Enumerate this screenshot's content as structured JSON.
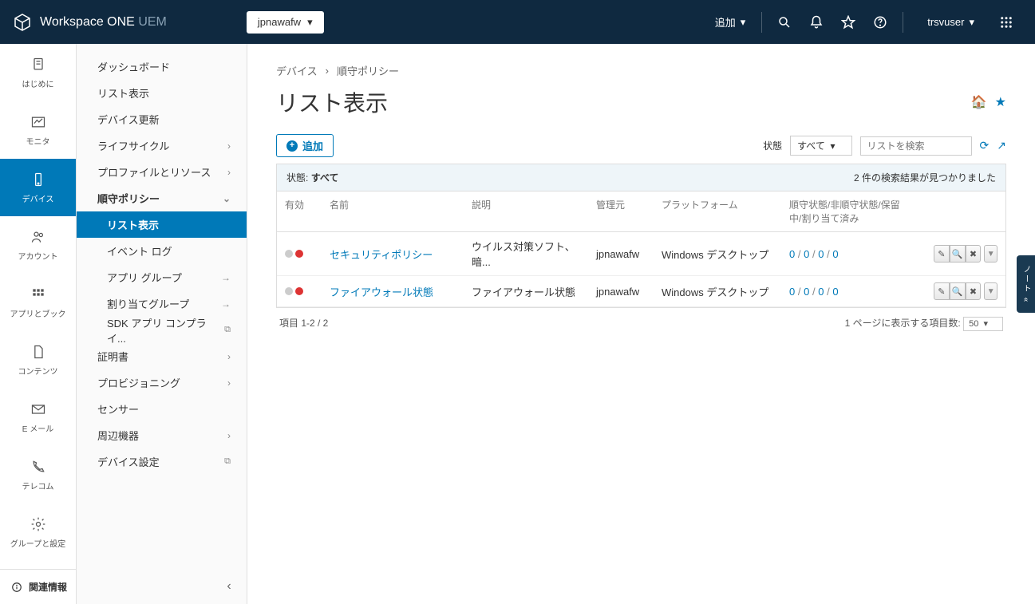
{
  "header": {
    "product": "Workspace ONE",
    "suffix": "UEM",
    "org": "jpnawafw",
    "add_label": "追加",
    "user": "trsvuser"
  },
  "rail": {
    "items": [
      {
        "label": "はじめに"
      },
      {
        "label": "モニタ"
      },
      {
        "label": "デバイス"
      },
      {
        "label": "アカウント"
      },
      {
        "label": "アプリとブック"
      },
      {
        "label": "コンテンツ"
      },
      {
        "label": "E メール"
      },
      {
        "label": "テレコム"
      },
      {
        "label": "グループと設定"
      }
    ],
    "footer": "関連情報"
  },
  "sidenav": {
    "items": [
      {
        "label": "ダッシュボード"
      },
      {
        "label": "リスト表示"
      },
      {
        "label": "デバイス更新"
      },
      {
        "label": "ライフサイクル",
        "chev": "›"
      },
      {
        "label": "プロファイルとリソース",
        "chev": "›"
      },
      {
        "label": "順守ポリシー",
        "chev": "⌄",
        "bold": true
      },
      {
        "label": "リスト表示",
        "sub": true,
        "active": true
      },
      {
        "label": "イベント ログ",
        "sub": true
      },
      {
        "label": "アプリ グループ",
        "chev": "→"
      },
      {
        "label": "割り当てグループ",
        "chev": "→"
      },
      {
        "label": "SDK アプリ コンプライ...",
        "ext": true
      },
      {
        "label": "証明書",
        "chev": "›"
      },
      {
        "label": "プロビジョニング",
        "chev": "›"
      },
      {
        "label": "センサー"
      },
      {
        "label": "周辺機器",
        "chev": "›"
      },
      {
        "label": "デバイス設定",
        "ext": true
      }
    ]
  },
  "breadcrumb": {
    "a": "デバイス",
    "b": "順守ポリシー"
  },
  "page_title": "リスト表示",
  "toolbar": {
    "add": "追加",
    "status_label": "状態",
    "status_value": "すべて",
    "search_placeholder": "リストを検索"
  },
  "table": {
    "filter_label": "状態:",
    "filter_value": "すべて",
    "result_text": "2 件の検索結果が見つかりました",
    "headers": {
      "enable": "有効",
      "name": "名前",
      "desc": "説明",
      "mgr": "管理元",
      "plat": "プラットフォーム",
      "stat": "順守状態/非順守状態/保留中/割り当て済み"
    },
    "rows": [
      {
        "name": "セキュリティポリシー",
        "desc": "ウイルス対策ソフト、暗...",
        "mgr": "jpnawafw",
        "plat": "Windows デスクトップ",
        "s1": "0",
        "s2": "0",
        "s3": "0",
        "s4": "0"
      },
      {
        "name": "ファイアウォール状態",
        "desc": "ファイアウォール状態",
        "mgr": "jpnawafw",
        "plat": "Windows デスクトップ",
        "s1": "0",
        "s2": "0",
        "s3": "0",
        "s4": "0"
      }
    ],
    "items_range": "項目 1-2 / 2",
    "page_size_label": "1 ページに表示する項目数:",
    "page_size": "50"
  },
  "side_tab": "ノート «"
}
